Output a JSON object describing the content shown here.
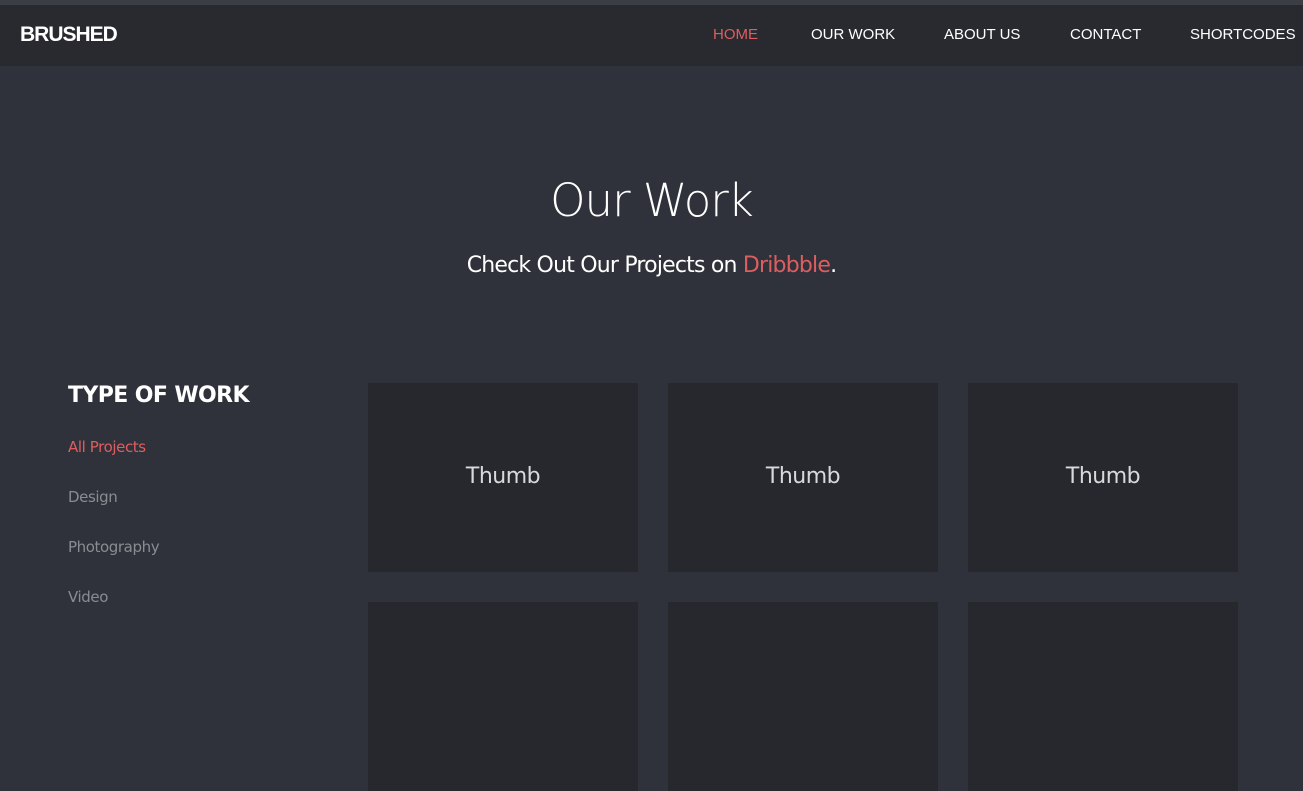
{
  "brand": {
    "logo": "BRUSHED"
  },
  "nav": {
    "items": [
      {
        "label": "HOME",
        "active": true
      },
      {
        "label": "OUR WORK",
        "active": false
      },
      {
        "label": "ABOUT US",
        "active": false
      },
      {
        "label": "CONTACT",
        "active": false
      },
      {
        "label": "SHORTCODES",
        "active": false
      }
    ]
  },
  "hero": {
    "title": "Our Work",
    "subtitle_prefix": "Check Out Our Projects on ",
    "subtitle_link": "Dribbble",
    "subtitle_suffix": "."
  },
  "sidebar": {
    "heading": "TYPE OF WORK",
    "filters": [
      {
        "label": "All Projects",
        "active": true
      },
      {
        "label": "Design",
        "active": false
      },
      {
        "label": "Photography",
        "active": false
      },
      {
        "label": "Video",
        "active": false
      }
    ]
  },
  "grid": {
    "thumbs": [
      {
        "label": "Thumb"
      },
      {
        "label": "Thumb"
      },
      {
        "label": "Thumb"
      },
      {
        "label": ""
      },
      {
        "label": ""
      },
      {
        "label": ""
      }
    ]
  },
  "colors": {
    "background": "#2f323a",
    "navbar": "#282a30",
    "tile": "#26282d",
    "accent": "#de5e60",
    "muted_text": "#8a8c92",
    "text": "#ffffff"
  }
}
